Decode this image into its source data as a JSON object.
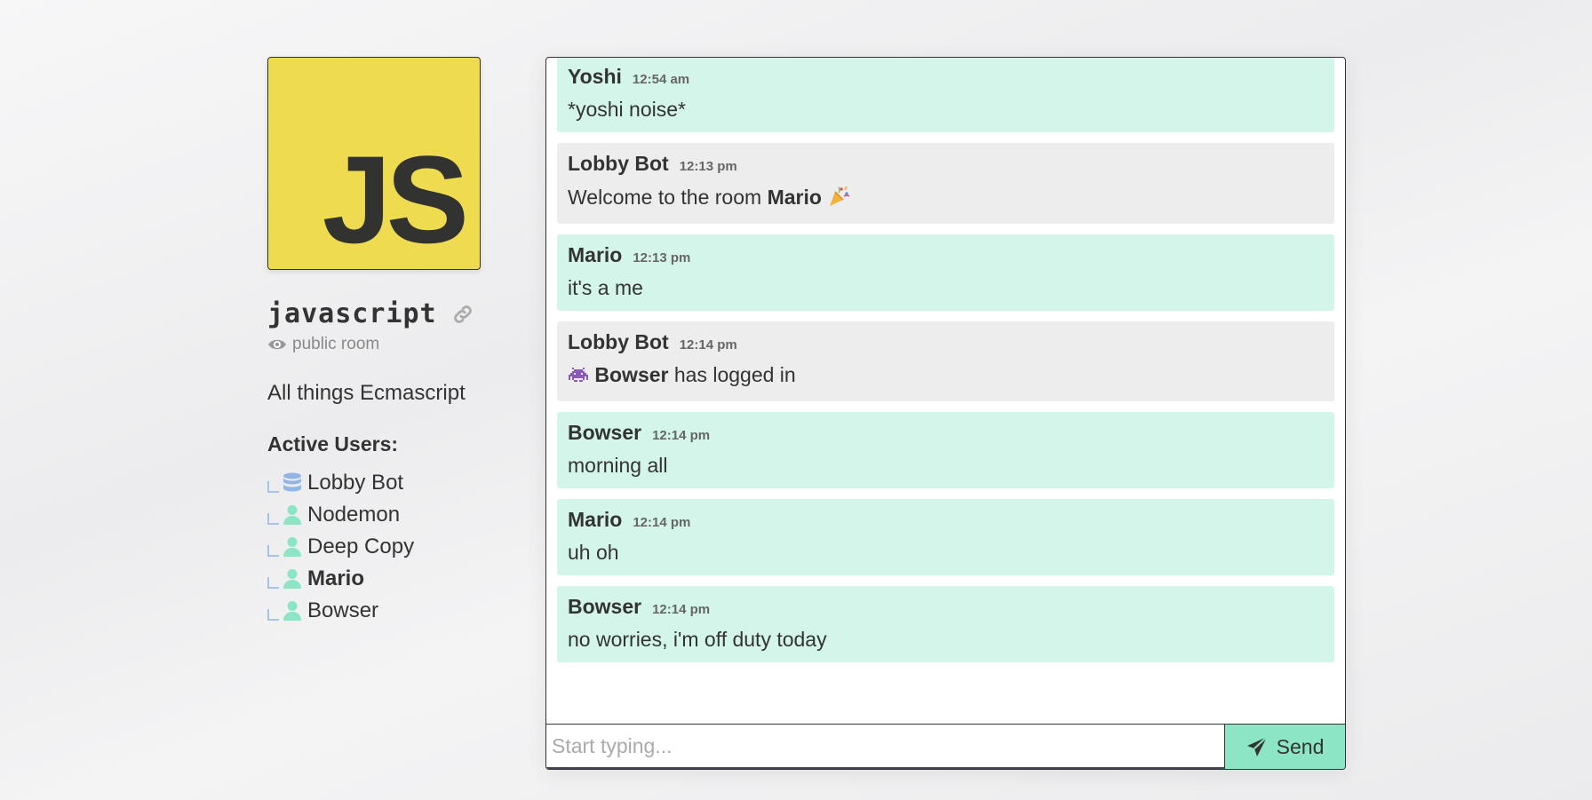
{
  "room": {
    "logo_text": "JS",
    "name": "javascript",
    "visibility": "public room",
    "description": "All things Ecmascript",
    "active_users_heading": "Active Users:",
    "users": [
      {
        "name": "Lobby Bot",
        "icon": "database-icon",
        "current": false
      },
      {
        "name": "Nodemon",
        "icon": "user-icon",
        "current": false
      },
      {
        "name": "Deep Copy",
        "icon": "user-icon",
        "current": false
      },
      {
        "name": "Mario",
        "icon": "user-icon",
        "current": true
      },
      {
        "name": "Bowser",
        "icon": "user-icon",
        "current": false
      }
    ]
  },
  "messages": [
    {
      "author": "Yoshi",
      "time": "12:54 am",
      "type": "user",
      "text": "*yoshi noise*"
    },
    {
      "author": "Lobby Bot",
      "time": "12:13 pm",
      "type": "bot",
      "prefix": "Welcome to the room",
      "highlight": "Mario",
      "emoji": "party-popper-icon"
    },
    {
      "author": "Mario",
      "time": "12:13 pm",
      "type": "user",
      "text": "it's a me"
    },
    {
      "author": "Lobby Bot",
      "time": "12:14 pm",
      "type": "bot",
      "emoji_before": "alien-monster-icon",
      "highlight": "Bowser",
      "suffix": "has logged in"
    },
    {
      "author": "Bowser",
      "time": "12:14 pm",
      "type": "user",
      "text": "morning all"
    },
    {
      "author": "Mario",
      "time": "12:14 pm",
      "type": "user",
      "text": "uh oh"
    },
    {
      "author": "Bowser",
      "time": "12:14 pm",
      "type": "user",
      "text": "no worries, i'm off duty today"
    }
  ],
  "composer": {
    "placeholder": "Start typing...",
    "send_label": "Send"
  },
  "colors": {
    "js_yellow": "#efdb50",
    "user_message_bg": "#d4f5e9",
    "bot_message_bg": "#ededed",
    "send_button_bg": "#8ce5c4",
    "user_icon": "#8ce5c4",
    "bot_icon": "#8fb6e6"
  }
}
